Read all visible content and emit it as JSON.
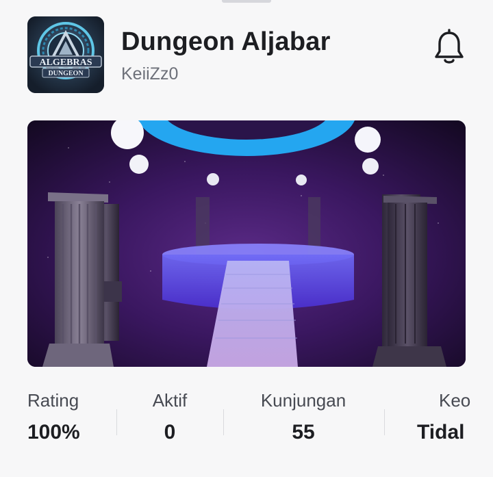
{
  "game": {
    "title": "Dungeon Aljabar",
    "creator": "KeiiZz0",
    "icon_text_top": "ALGEBRAS",
    "icon_text_bottom": "DUNGEON"
  },
  "stats": [
    {
      "label": "Rating",
      "value": "100%"
    },
    {
      "label": "Aktif",
      "value": "0"
    },
    {
      "label": "Kunjungan",
      "value": "55"
    },
    {
      "label": "Keo",
      "value": "Tidal"
    }
  ],
  "icons": {
    "bell": "bell-icon"
  }
}
